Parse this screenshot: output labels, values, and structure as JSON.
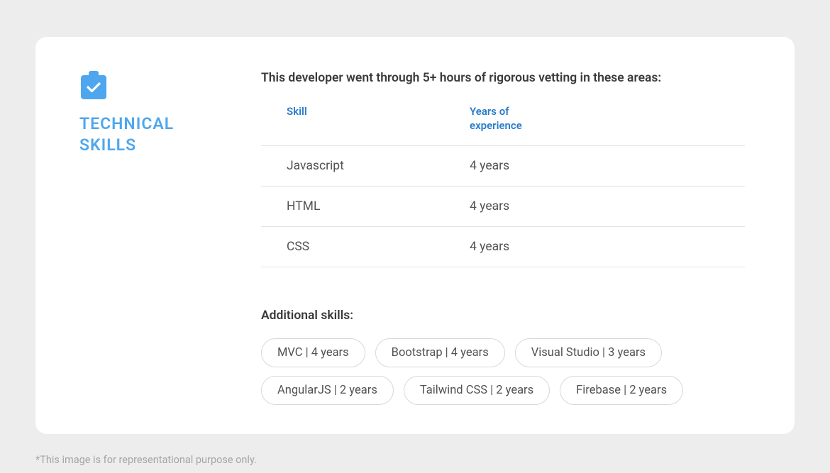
{
  "section": {
    "title_line1": "TECHNICAL",
    "title_line2": "SKILLS"
  },
  "intro": "This developer went through 5+ hours of rigorous vetting in these areas:",
  "table": {
    "headers": {
      "skill": "Skill",
      "years": "Years of experience"
    },
    "rows": [
      {
        "skill": "Javascript",
        "years": "4 years"
      },
      {
        "skill": "HTML",
        "years": "4 years"
      },
      {
        "skill": "CSS",
        "years": "4 years"
      }
    ]
  },
  "additional": {
    "title": "Additional skills:",
    "items": [
      "MVC | 4 years",
      "Bootstrap | 4 years",
      "Visual Studio | 3 years",
      "AngularJS | 2 years",
      "Tailwind CSS | 2 years",
      "Firebase | 2 years"
    ]
  },
  "footnote": "*This image is for representational purpose only."
}
